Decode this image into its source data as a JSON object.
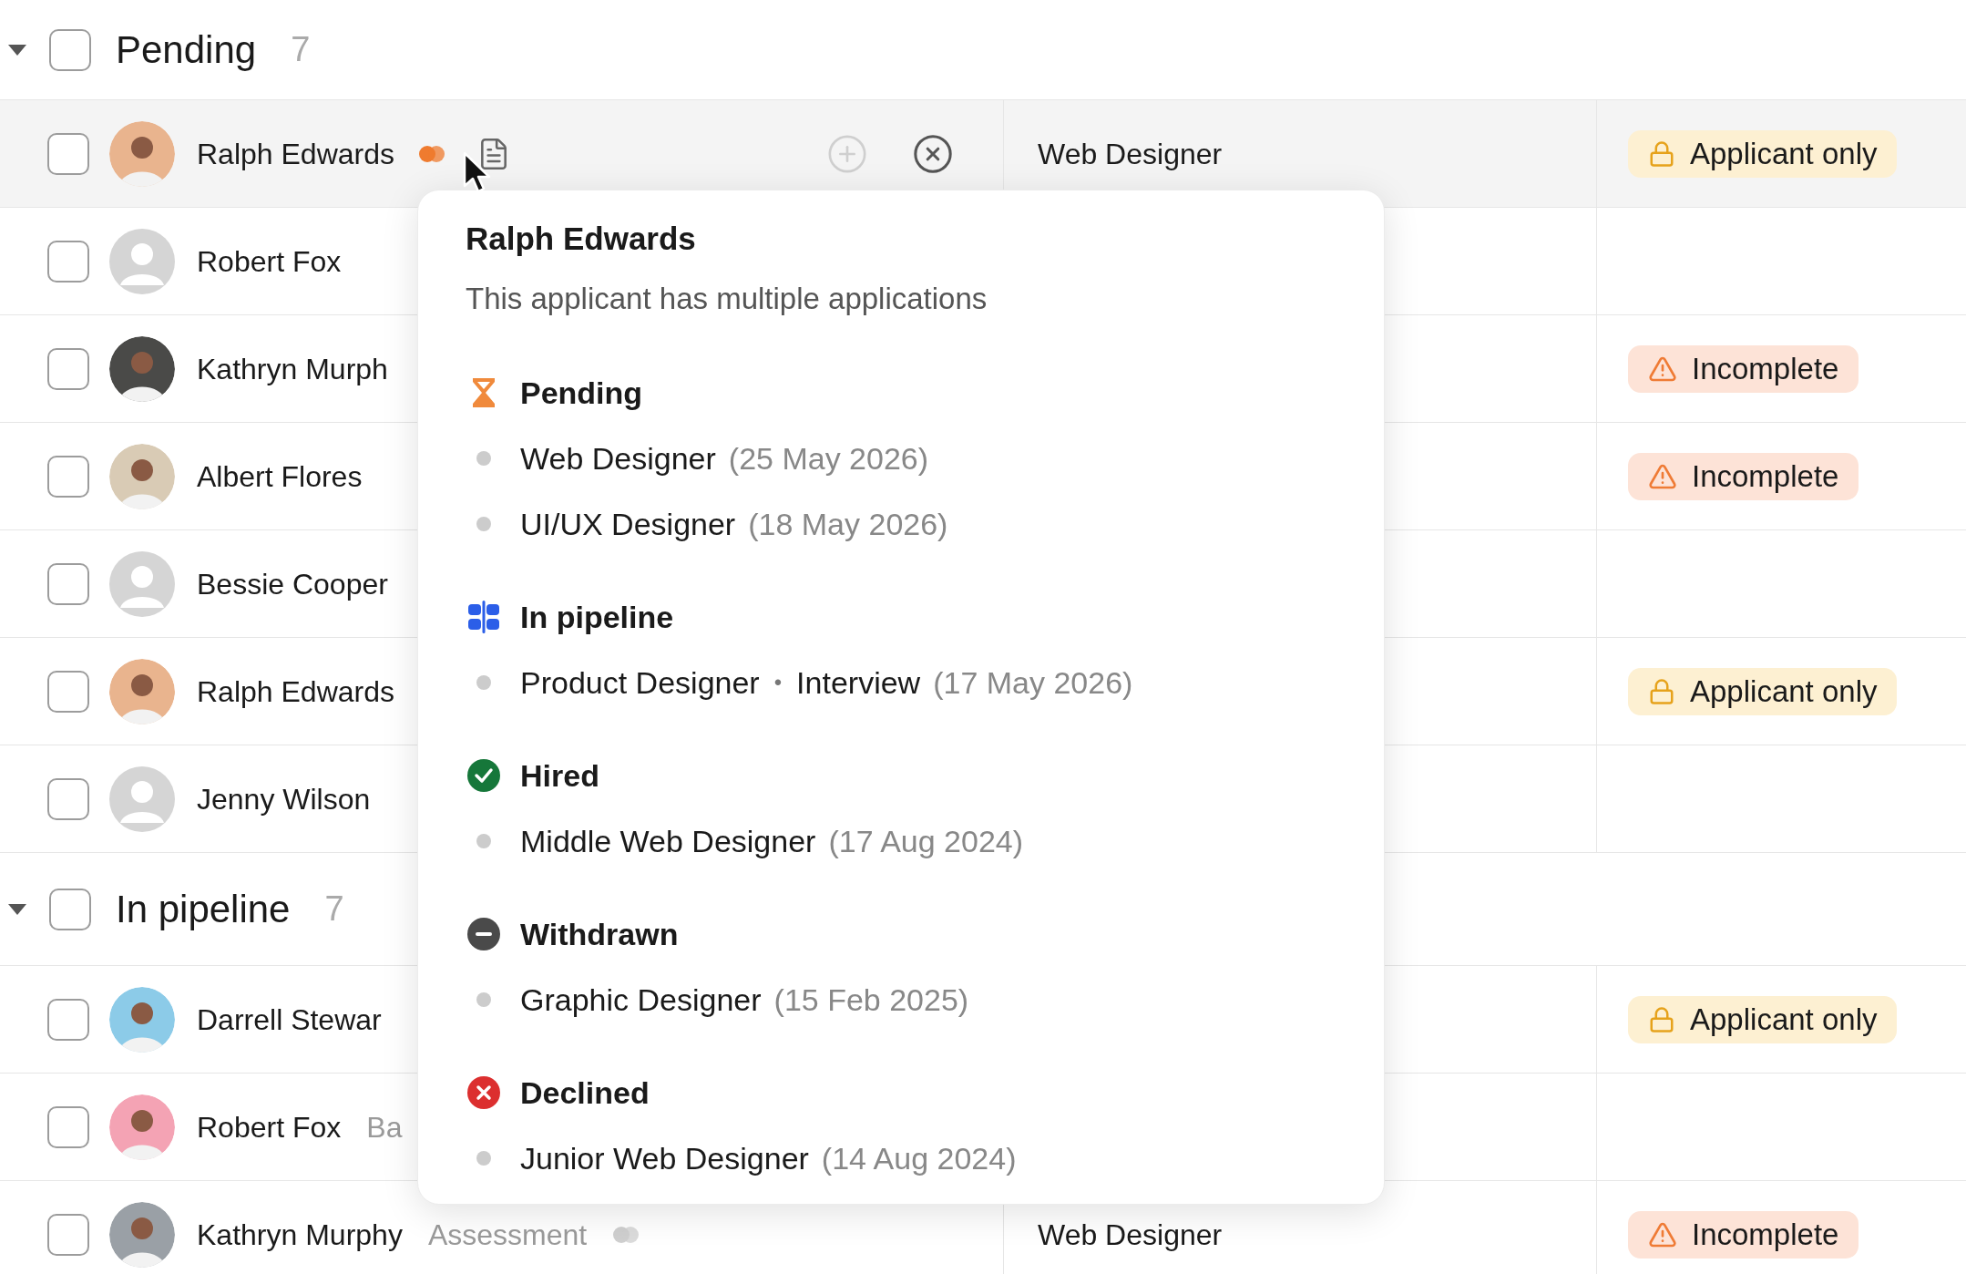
{
  "groups": [
    {
      "title": "Pending",
      "count": "7",
      "expanded": true,
      "checked": false,
      "rows": [
        {
          "name": "Ralph Edwards",
          "avatar": {
            "kind": "photo",
            "color": "#e9b48e"
          },
          "checked": false,
          "hovered": true,
          "position": "Web Designer",
          "tag": {
            "kind": "applicant_only",
            "label": "Applicant only"
          }
        },
        {
          "name": "Robert Fox",
          "avatar": {
            "kind": "placeholder"
          },
          "checked": false,
          "hovered": false
        },
        {
          "name": "Kathryn Murph",
          "avatar": {
            "kind": "photo",
            "color": "#4a4a48"
          },
          "checked": false,
          "hovered": false,
          "tag": {
            "kind": "incomplete",
            "label": "Incomplete"
          }
        },
        {
          "name": "Albert Flores",
          "avatar": {
            "kind": "photo",
            "color": "#d9cbb5"
          },
          "checked": false,
          "hovered": false,
          "tag": {
            "kind": "incomplete",
            "label": "Incomplete"
          }
        },
        {
          "name": "Bessie Cooper",
          "avatar": {
            "kind": "placeholder"
          },
          "checked": false,
          "hovered": false
        },
        {
          "name": "Ralph Edwards",
          "avatar": {
            "kind": "photo",
            "color": "#e9b48e"
          },
          "checked": false,
          "hovered": false,
          "tag": {
            "kind": "applicant_only",
            "label": "Applicant only"
          }
        },
        {
          "name": "Jenny Wilson",
          "avatar": {
            "kind": "placeholder"
          },
          "checked": false,
          "hovered": false
        }
      ]
    },
    {
      "title": "In pipeline",
      "count": "7",
      "expanded": true,
      "checked": false,
      "rows": [
        {
          "name": "Darrell Stewar",
          "avatar": {
            "kind": "photo",
            "color": "#8ccbe8"
          },
          "checked": false,
          "hovered": false,
          "tag": {
            "kind": "applicant_only",
            "label": "Applicant only"
          }
        },
        {
          "name": "Robert Fox",
          "stage": "Ba",
          "avatar": {
            "kind": "photo",
            "color": "#f4a3b4"
          },
          "checked": false,
          "hovered": false
        },
        {
          "name": "Kathryn Murphy",
          "stage": "Assessment",
          "stage_icon": true,
          "avatar": {
            "kind": "photo",
            "color": "#9aa0a6"
          },
          "checked": false,
          "hovered": false,
          "position": "Web Designer",
          "tag": {
            "kind": "incomplete",
            "label": "Incomplete"
          }
        }
      ]
    }
  ],
  "popover": {
    "title": "Ralph Edwards",
    "subtitle": "This applicant has multiple applications",
    "sections": [
      {
        "kind": "pending",
        "title": "Pending",
        "items": [
          {
            "title": "Web Designer",
            "date": "(25 May 2026)"
          },
          {
            "title": "UI/UX Designer",
            "date": "(18 May 2026)"
          }
        ]
      },
      {
        "kind": "pipeline",
        "title": "In pipeline",
        "items": [
          {
            "title": "Product Designer",
            "separator": "•",
            "stage": "Interview",
            "date": "(17 May 2026)"
          }
        ]
      },
      {
        "kind": "hired",
        "title": "Hired",
        "items": [
          {
            "title": "Middle Web Designer",
            "date": "(17 Aug 2024)"
          }
        ]
      },
      {
        "kind": "withdrawn",
        "title": "Withdrawn",
        "items": [
          {
            "title": "Graphic Designer",
            "date": "(15 Feb 2025)"
          }
        ]
      },
      {
        "kind": "declined",
        "title": "Declined",
        "items": [
          {
            "title": "Junior Web Designer",
            "date": "(14 Aug 2024)"
          }
        ]
      }
    ]
  }
}
